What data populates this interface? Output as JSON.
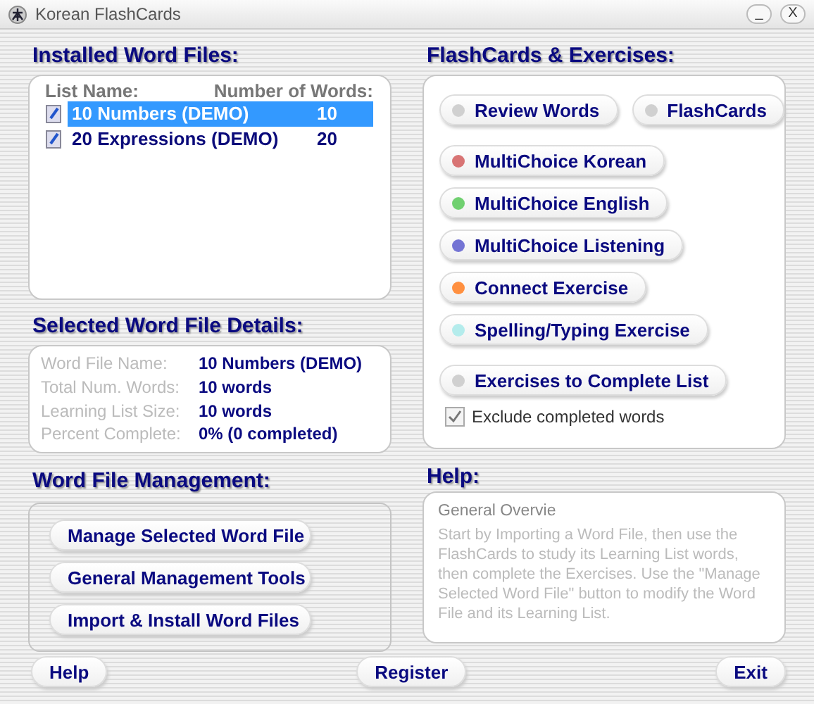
{
  "window": {
    "title": "Korean FlashCards",
    "controls": [
      "_",
      "X"
    ]
  },
  "installed": {
    "heading": "Installed Word Files:",
    "columns": [
      "List Name:",
      "Number of Words:"
    ],
    "rows": [
      {
        "name": "10 Numbers (DEMO)",
        "count": "10",
        "selected": true
      },
      {
        "name": "20 Expressions (DEMO)",
        "count": "20",
        "selected": false
      }
    ]
  },
  "details": {
    "heading": "Selected Word File Details:",
    "fields": [
      {
        "label": "Word File Name:",
        "value": "10 Numbers (DEMO)"
      },
      {
        "label": "Total Num. Words:",
        "value": "10 words"
      },
      {
        "label": "Learning List Size:",
        "value": "10 words"
      },
      {
        "label": "Percent Complete:",
        "value": "0% (0 completed)"
      }
    ]
  },
  "management": {
    "heading": "Word File Management:",
    "buttons": [
      "Manage Selected Word File",
      "General Management Tools",
      "Import & Install Word Files"
    ]
  },
  "exercises": {
    "heading": "FlashCards & Exercises:",
    "groups": [
      [
        {
          "label": "Review Words",
          "color": "#d0d0d0"
        },
        {
          "label": "FlashCards",
          "color": "#d0d0d0"
        }
      ],
      [
        {
          "label": "MultiChoice Korean",
          "color": "#d87474"
        },
        {
          "label": "MultiChoice English",
          "color": "#70d070"
        },
        {
          "label": "MultiChoice Listening",
          "color": "#7474d4"
        },
        {
          "label": "Connect Exercise",
          "color": "#ff9040"
        },
        {
          "label": "Spelling/Typing Exercise",
          "color": "#b4ecec"
        }
      ],
      [
        {
          "label": "Exercises to Complete List",
          "color": "#d0d0d0"
        }
      ]
    ],
    "exclude": {
      "label": "Exclude completed words",
      "checked": true
    }
  },
  "help": {
    "heading": "Help:",
    "title": "General Overvie",
    "text": "Start by Importing a Word File, then use the FlashCards to study its Learning List words, then complete the Exercises. Use the \"Manage Selected Word File\" button to modify the Word File and its Learning List."
  },
  "footer": [
    "Help",
    "Register",
    "Exit"
  ]
}
